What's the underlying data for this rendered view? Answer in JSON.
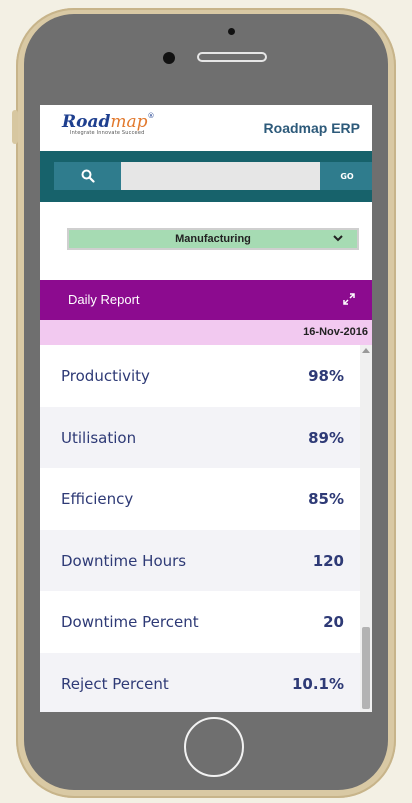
{
  "app": {
    "logo_text_road": "Road",
    "logo_text_map": "map",
    "logo_reg": "®",
    "logo_tagline": "Integrate Innovate Succeed",
    "title": "Roadmap ERP"
  },
  "search": {
    "placeholder": "",
    "value": "",
    "go_label": "GO"
  },
  "department": {
    "selected": "Manufacturing"
  },
  "report": {
    "title": "Daily Report",
    "date": "16-Nov-2016",
    "metrics": [
      {
        "label": "Productivity",
        "value": "98%"
      },
      {
        "label": "Utilisation",
        "value": "89%"
      },
      {
        "label": "Efficiency",
        "value": "85%"
      },
      {
        "label": "Downtime Hours",
        "value": "120"
      },
      {
        "label": "Downtime Percent",
        "value": "20"
      },
      {
        "label": "Reject Percent",
        "value": "10.1%"
      }
    ]
  },
  "colors": {
    "header_teal": "#17626b",
    "button_teal": "#2f7c8d",
    "report_purple": "#8c0b8f",
    "date_pink": "#f2c9f0",
    "select_green": "#a6dbb3",
    "metric_text": "#2e3a76"
  }
}
